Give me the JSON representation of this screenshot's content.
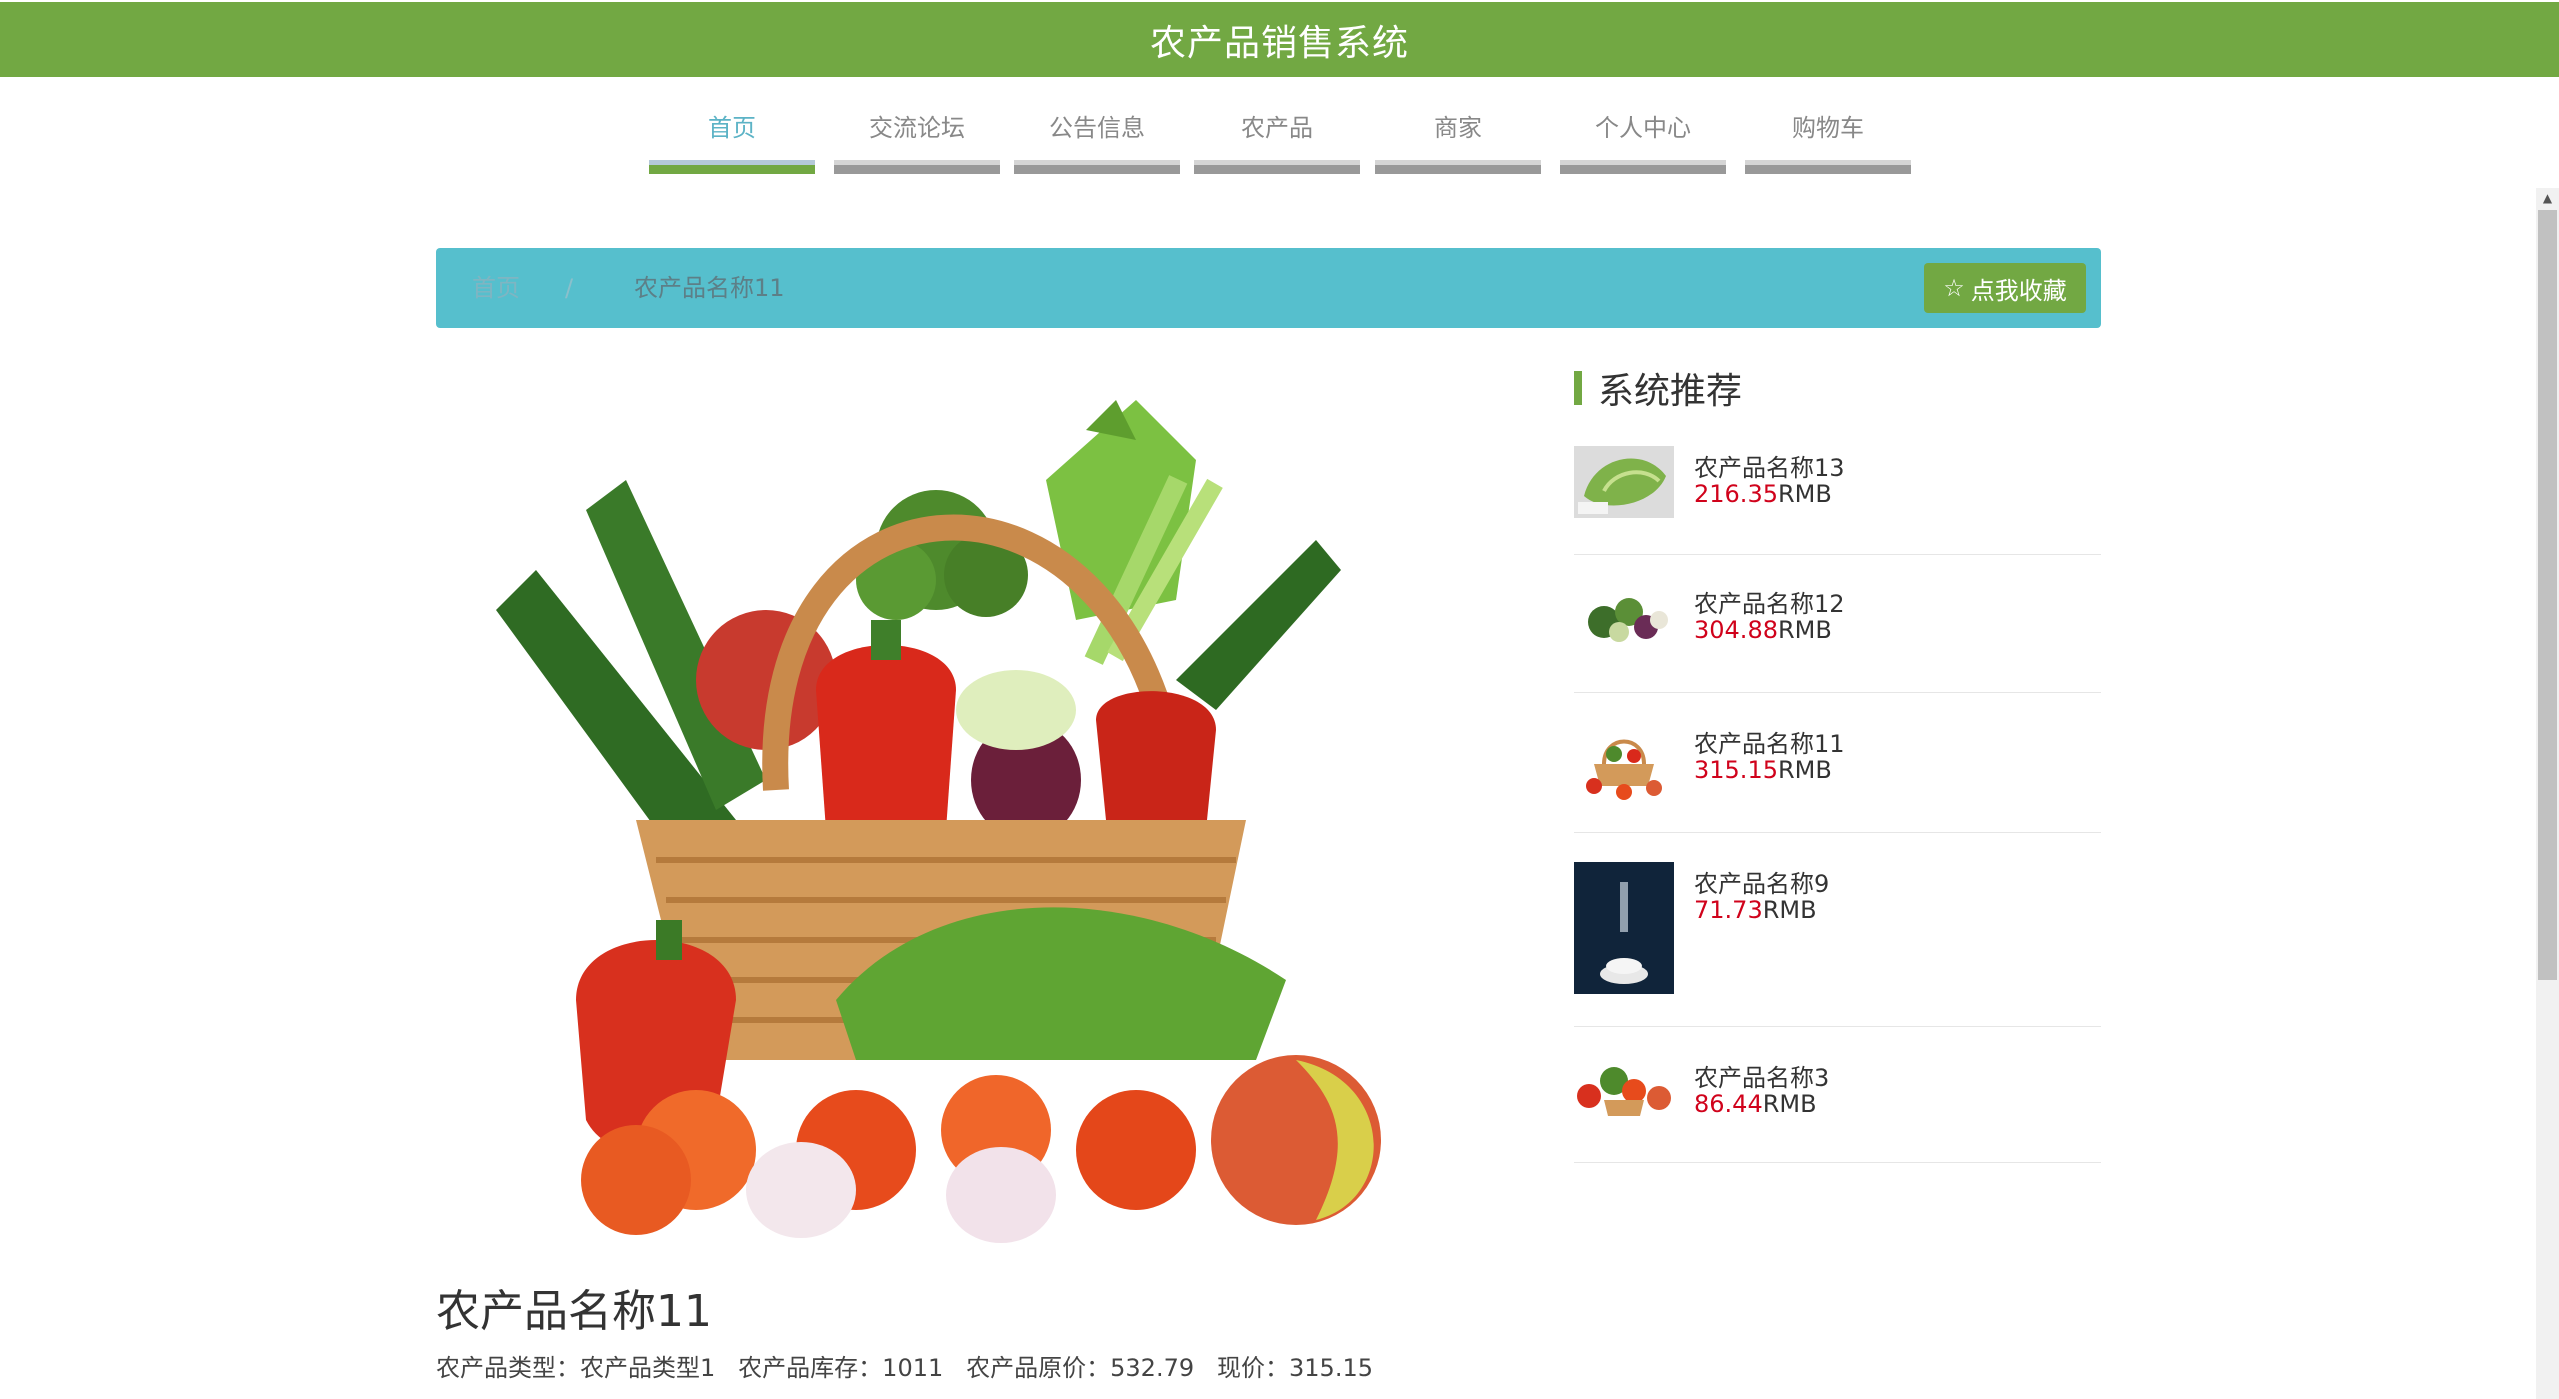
{
  "header": {
    "title": "农产品销售系统"
  },
  "nav": {
    "items": [
      {
        "label": "首页",
        "active": true
      },
      {
        "label": "交流论坛",
        "active": false
      },
      {
        "label": "公告信息",
        "active": false
      },
      {
        "label": "农产品",
        "active": false
      },
      {
        "label": "商家",
        "active": false
      },
      {
        "label": "个人中心",
        "active": false
      },
      {
        "label": "购物车",
        "active": false
      }
    ]
  },
  "breadcrumb": {
    "home": "首页",
    "separator": "/",
    "current": "农产品名称11",
    "favorite_button": "点我收藏",
    "favorite_icon": "star-outline-icon"
  },
  "product": {
    "image": "vegetable-basket-image",
    "title": "农产品名称11",
    "meta": {
      "type_label": "农产品类型：",
      "type_value": "农产品类型1",
      "stock_label": "农产品库存：",
      "stock_value": "1011",
      "original_price_label": "农产品原价：",
      "original_price_value": "532.79",
      "current_price_label": "现价：",
      "current_price_value": "315.15"
    }
  },
  "recommend": {
    "heading": "系统推荐",
    "currency": "RMB",
    "items": [
      {
        "name": "农产品名称13",
        "price": "216.35",
        "image": "cabbage-image"
      },
      {
        "name": "农产品名称12",
        "price": "304.88",
        "image": "vegetables-pile-image"
      },
      {
        "name": "农产品名称11",
        "price": "315.15",
        "image": "vegetable-basket-image"
      },
      {
        "name": "农产品名称9",
        "price": "71.73",
        "image": "rice-poster-image"
      },
      {
        "name": "农产品名称3",
        "price": "86.44",
        "image": "vegetable-basket-2-image"
      }
    ]
  },
  "colors": {
    "brand_green": "#72a843",
    "breadcrumb_teal": "#56bfcd",
    "active_nav_text": "#5cb3c6",
    "price_red": "#d0021b"
  }
}
